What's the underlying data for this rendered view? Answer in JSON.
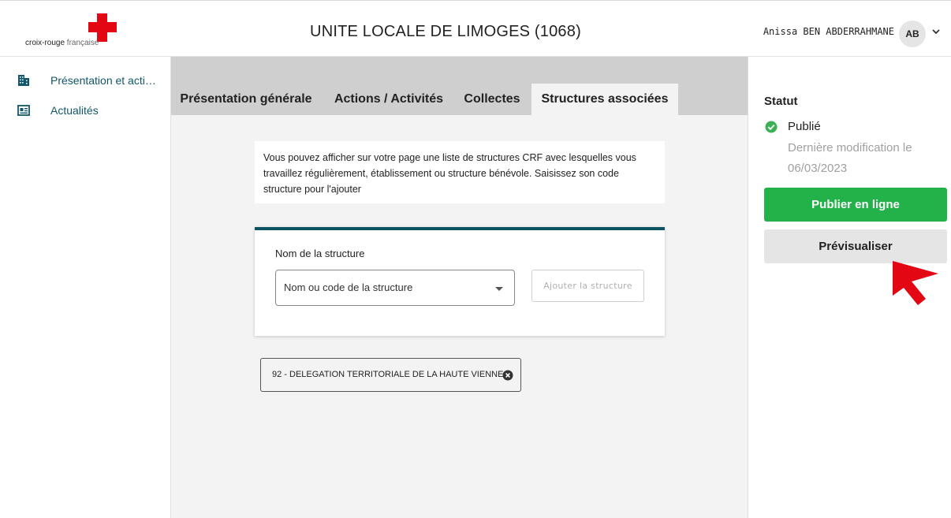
{
  "header": {
    "logo_main": "croix-rouge",
    "logo_light": " française",
    "title": "UNITE LOCALE DE LIMOGES (1068)",
    "user_name": "Anissa BEN ABDERRAHMANE",
    "avatar_initials": "AB"
  },
  "sidebar": {
    "items": [
      {
        "label": "Présentation et activités",
        "icon": "building-icon"
      },
      {
        "label": "Actualités",
        "icon": "newspaper-icon"
      }
    ]
  },
  "tabs": [
    {
      "label": "Présentation générale",
      "active": false
    },
    {
      "label": "Actions / Activités",
      "active": false
    },
    {
      "label": "Collectes",
      "active": false
    },
    {
      "label": "Structures associées",
      "active": true
    }
  ],
  "info_text": "Vous pouvez afficher sur votre page une liste de structures CRF avec lesquelles vous travaillez régulièrement, établissement ou structure bénévole. Saisissez son code structure pour l'ajouter",
  "form": {
    "label": "Nom de la structure",
    "select_placeholder": "Nom ou code de la structure",
    "add_button": "Ajouter la structure"
  },
  "chips": [
    {
      "label": "92 - DELEGATION TERRITORIALE DE LA HAUTE VIENNE"
    }
  ],
  "status_panel": {
    "heading": "Statut",
    "status": "Publié",
    "last_modified": "Dernière modification le 06/03/2023",
    "publish_button": "Publier en ligne",
    "preview_button": "Prévisualiser"
  },
  "colors": {
    "brand_red": "#e30613",
    "teal": "#0c5260",
    "publish_green": "#23b24a",
    "link_teal": "#11566a"
  }
}
